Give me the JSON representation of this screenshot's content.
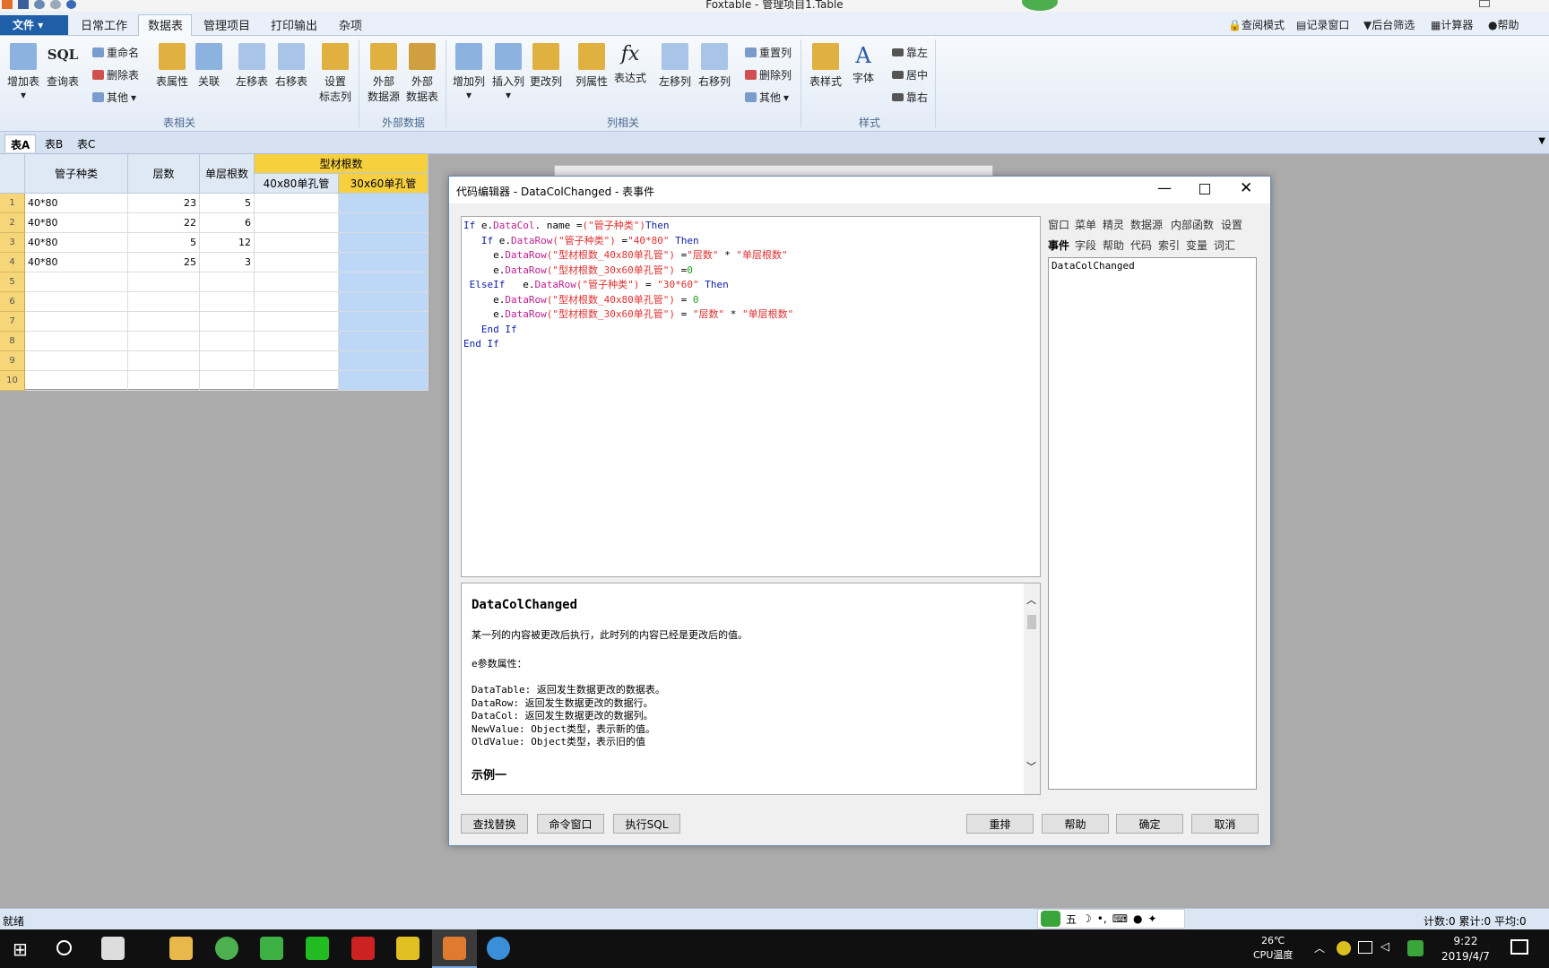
{
  "window": {
    "title": "Foxtable - 管理项目1.Table"
  },
  "menubar": {
    "file": "文件",
    "tabs": [
      "日常工作",
      "数据表",
      "管理项目",
      "打印输出",
      "杂项"
    ],
    "right_links": [
      "查阅模式",
      "记录窗口",
      "后台筛选",
      "计算器",
      "帮助"
    ]
  },
  "ribbon": {
    "table_group": {
      "add": "增加表",
      "sql": "SQL",
      "query": "查询表",
      "rename": "重命名",
      "delete": "删除表",
      "other": "其他",
      "props": "表属性",
      "relate": "关联",
      "move_left": "左移表",
      "move_right": "右移表",
      "set_flag1": "设置",
      "set_flag2": "标志列",
      "label": "表相关"
    },
    "ext_group": {
      "src1": "外部",
      "src2": "数据源",
      "tbl1": "外部",
      "tbl2": "数据表",
      "label": "外部数据"
    },
    "col_group": {
      "add": "增加列",
      "insert": "插入列",
      "change": "更改列",
      "props": "列属性",
      "expr": "表达式",
      "move_left": "左移列",
      "move_right": "右移列",
      "reset": "重置列",
      "delete": "删除列",
      "other": "其他",
      "label": "列相关"
    },
    "style_group": {
      "style": "表样式",
      "font": "字体",
      "left": "靠左",
      "center": "居中",
      "right": "靠右",
      "label": "样式"
    }
  },
  "sheet_tabs": [
    "表A",
    "表B",
    "表C"
  ],
  "grid": {
    "group_header": "型材根数",
    "headers": [
      "管子种类",
      "层数",
      "单层根数",
      "40x80单孔管",
      "30x60单孔管"
    ],
    "rows": [
      [
        "40*80",
        "23",
        "5",
        "",
        ""
      ],
      [
        "40*80",
        "22",
        "6",
        "",
        ""
      ],
      [
        "40*80",
        "5",
        "12",
        "",
        ""
      ],
      [
        "40*80",
        "25",
        "3",
        "",
        ""
      ],
      [
        "",
        "",
        "",
        "",
        ""
      ],
      [
        "",
        "",
        "",
        "",
        ""
      ],
      [
        "",
        "",
        "",
        "",
        ""
      ],
      [
        "",
        "",
        "",
        "",
        ""
      ],
      [
        "",
        "",
        "",
        "",
        ""
      ],
      [
        "",
        "",
        "",
        "",
        ""
      ]
    ],
    "row_numbers": [
      "1",
      "2",
      "3",
      "4",
      "5",
      "6",
      "7",
      "8",
      "9",
      "10"
    ]
  },
  "dialog": {
    "title": "代码编辑器 - DataColChanged - 表事件",
    "code": [
      [
        [
          "kw",
          "If "
        ],
        [
          "",
          "e."
        ],
        [
          "pr",
          "DataCol"
        ],
        [
          "",
          ". name ="
        ],
        [
          "st",
          "(\"管子种类\")"
        ],
        [
          "kw",
          "Then"
        ]
      ],
      [
        [
          "",
          "   "
        ],
        [
          "kw",
          "If "
        ],
        [
          "",
          "e."
        ],
        [
          "pr",
          "DataRow"
        ],
        [
          "st",
          "(\"管子种类\")"
        ],
        [
          "",
          " ="
        ],
        [
          "st",
          "\"40*80\" "
        ],
        [
          "kw",
          "Then"
        ]
      ],
      [
        [
          "",
          "     e."
        ],
        [
          "pr",
          "DataRow"
        ],
        [
          "st",
          "(\"型材根数_40x80单孔管\")"
        ],
        [
          "",
          " ="
        ],
        [
          "st",
          "\"层数\""
        ],
        [
          "",
          " * "
        ],
        [
          "st",
          "\"单层根数\""
        ]
      ],
      [
        [
          "",
          "     e."
        ],
        [
          "pr",
          "DataRow"
        ],
        [
          "st",
          "(\"型材根数_30x60单孔管\")"
        ],
        [
          "",
          " ="
        ],
        [
          "nm",
          "0"
        ]
      ],
      [
        [
          "",
          " "
        ],
        [
          "kw",
          "ElseIf "
        ],
        [
          "",
          "  e."
        ],
        [
          "pr",
          "DataRow"
        ],
        [
          "st",
          "(\"管子种类\")"
        ],
        [
          "",
          " = "
        ],
        [
          "st",
          "\"30*60\" "
        ],
        [
          "kw",
          "Then"
        ]
      ],
      [
        [
          "",
          "     e."
        ],
        [
          "pr",
          "DataRow"
        ],
        [
          "st",
          "(\"型材根数_40x80单孔管\")"
        ],
        [
          "",
          " = "
        ],
        [
          "nm",
          "0"
        ]
      ],
      [
        [
          "",
          "     e."
        ],
        [
          "pr",
          "DataRow"
        ],
        [
          "st",
          "(\"型材根数_30x60单孔管\")"
        ],
        [
          "",
          " = "
        ],
        [
          "st",
          "\"层数\""
        ],
        [
          "",
          " * "
        ],
        [
          "st",
          "\"单层根数\""
        ]
      ],
      [
        [
          "",
          "   "
        ],
        [
          "kw",
          "End If"
        ]
      ],
      [
        [
          "kw",
          "End If"
        ]
      ]
    ],
    "help": {
      "heading": "DataColChanged",
      "desc": "某一列的内容被更改后执行，此时列的内容已经是更改后的值。",
      "params_title": "e参数属性：",
      "params": [
        "DataTable: 返回发生数据更改的数据表。",
        "DataRow:   返回发生数据更改的数据行。",
        "DataCol:   返回发生数据更改的数据列。",
        "NewValue:  Object类型，表示新的值。",
        "OldValue:  Object类型，表示旧的值"
      ],
      "example": "示例一"
    },
    "right_tabs_row1": [
      "窗口",
      "菜单",
      "精灵",
      "数据源",
      "内部函数",
      "设置"
    ],
    "right_tabs_row2": [
      "事件",
      "字段",
      "帮助",
      "代码",
      "索引",
      "变量",
      "词汇"
    ],
    "event_list": [
      "DataColChanged"
    ],
    "buttons_left": [
      "查找替换",
      "命令窗口",
      "执行SQL"
    ],
    "buttons_right": [
      "重排",
      "帮助",
      "确定",
      "取消"
    ]
  },
  "statusbar": {
    "left": "就绪",
    "right": "计数:0 累计:0 平均:0",
    "ime": "五"
  },
  "taskbar": {
    "temp": "26℃",
    "temp_label": "CPU温度",
    "time": "9:22",
    "date": "2019/4/7"
  },
  "colors": {
    "accent": "#1f5fa8",
    "row_header": "#f7d679",
    "selected_col": "#bcd8f6"
  }
}
